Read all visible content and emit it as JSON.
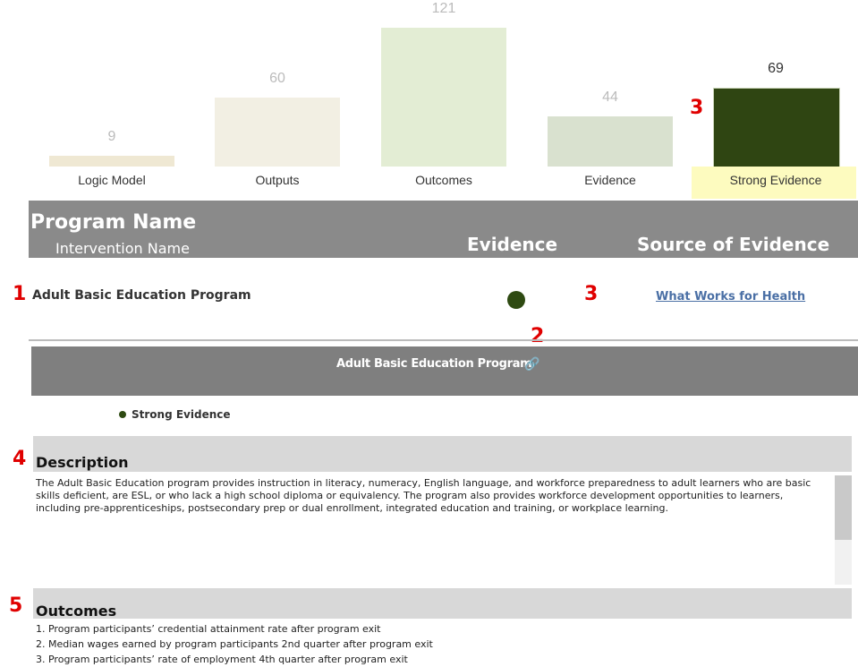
{
  "chart_data": {
    "type": "bar",
    "categories": [
      "Logic Model",
      "Outputs",
      "Outcomes",
      "Evidence",
      "Strong Evidence"
    ],
    "values": [
      9,
      60,
      121,
      44,
      69
    ],
    "colors": [
      "#efe8d3",
      "#f2efe3",
      "#e3edd4",
      "#d9e1cf",
      "#2f4512"
    ],
    "highlight_category": "Strong Evidence",
    "highlight_color": "#fdfbbf",
    "ylim": [
      0,
      121
    ]
  },
  "markers": [
    "3",
    "1",
    "3",
    "2",
    "4",
    "5"
  ],
  "table": {
    "header_program": "Program Name",
    "header_intervention": "Intervention Name",
    "header_evidence": "Evidence",
    "header_source": "Source of Evidence",
    "row": {
      "program": "Adult Basic Education Program",
      "evidence_color": "#2e4a12",
      "source_link": "What Works for Health"
    }
  },
  "detail": {
    "title": "Adult Basic Education Program",
    "link_icon": "link-icon",
    "evidence_level": "Strong Evidence",
    "description_title": "Description",
    "description": "The Adult Basic Education program provides instruction in literacy, numeracy, English language, and workforce preparedness to adult learners who are basic skills deficient, are ESL, or who lack a high school diploma or equivalency. The program also provides workforce development opportunities to learners, including pre-apprenticeships, postsecondary prep or dual enrollment, integrated education and training, or workplace learning.",
    "outcomes_title": "Outcomes",
    "outcomes": [
      "1. Program participants’ credential attainment rate after program exit",
      "2. Median wages earned by program participants 2nd quarter after program exit",
      "3. Program participants’ rate of employment 4th quarter after program exit"
    ]
  }
}
